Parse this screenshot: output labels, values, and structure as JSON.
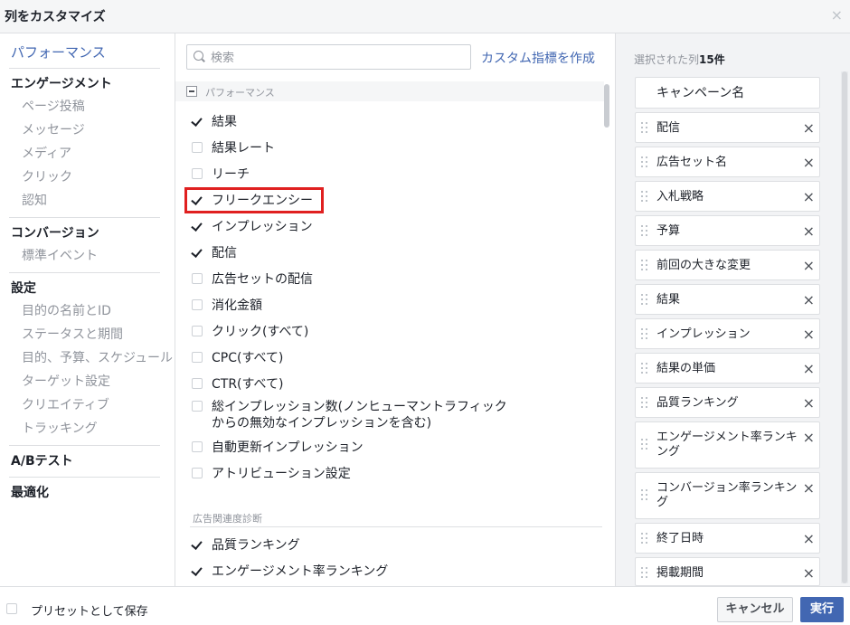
{
  "dialog": {
    "title": "列をカスタマイズ",
    "close": "×"
  },
  "nav": {
    "top": "パフォーマンス",
    "engagement": {
      "label": "エンゲージメント",
      "items": [
        "ページ投稿",
        "メッセージ",
        "メディア",
        "クリック",
        "認知"
      ]
    },
    "conversion": {
      "label": "コンバージョン",
      "items": [
        "標準イベント"
      ]
    },
    "settings": {
      "label": "設定",
      "items": [
        "目的の名前とID",
        "ステータスと期間",
        "目的、予算、スケジュール",
        "ターゲット設定",
        "クリエイティブ",
        "トラッキング"
      ]
    },
    "abtest": "A/Bテスト",
    "optimize": "最適化"
  },
  "search": {
    "placeholder": "検索",
    "value": ""
  },
  "create_metric": "カスタム指標を作成",
  "section": {
    "label": "パフォーマンス"
  },
  "metrics": [
    {
      "label": "結果",
      "checked": true
    },
    {
      "label": "結果レート",
      "checked": false
    },
    {
      "label": "リーチ",
      "checked": false
    },
    {
      "label": "フリークエンシー",
      "checked": true
    },
    {
      "label": "インプレッション",
      "checked": true
    },
    {
      "label": "配信",
      "checked": true
    },
    {
      "label": "広告セットの配信",
      "checked": false
    },
    {
      "label": "消化金額",
      "checked": false
    },
    {
      "label": "クリック(すべて)",
      "checked": false
    },
    {
      "label": "CPC(すべて)",
      "checked": false
    },
    {
      "label": "CTR(すべて)",
      "checked": false
    },
    {
      "label": "総インプレッション数(ノンヒューマントラフィックからの無効なインプレッションを含む)",
      "checked": false
    },
    {
      "label": "自動更新インプレッション",
      "checked": false
    },
    {
      "label": "アトリビューション設定",
      "checked": false
    }
  ],
  "relevance": {
    "label": "広告関連度診断",
    "items": [
      {
        "label": "品質ランキング",
        "checked": true
      },
      {
        "label": "エンゲージメント率ランキング",
        "checked": true
      }
    ]
  },
  "selected": {
    "title_prefix": "選択された列",
    "count": "15件",
    "fixed": "キャンペーン名",
    "items": [
      "配信",
      "広告セット名",
      "入札戦略",
      "予算",
      "前回の大きな変更",
      "結果",
      "インプレッション",
      "結果の単価",
      "品質ランキング",
      "エンゲージメント率ランキング",
      "コンバージョン率ランキング",
      "終了日時",
      "掲載期間"
    ],
    "remove": "×"
  },
  "footer": {
    "preset": "プリセットとして保存",
    "cancel": "キャンセル",
    "run": "実行"
  }
}
